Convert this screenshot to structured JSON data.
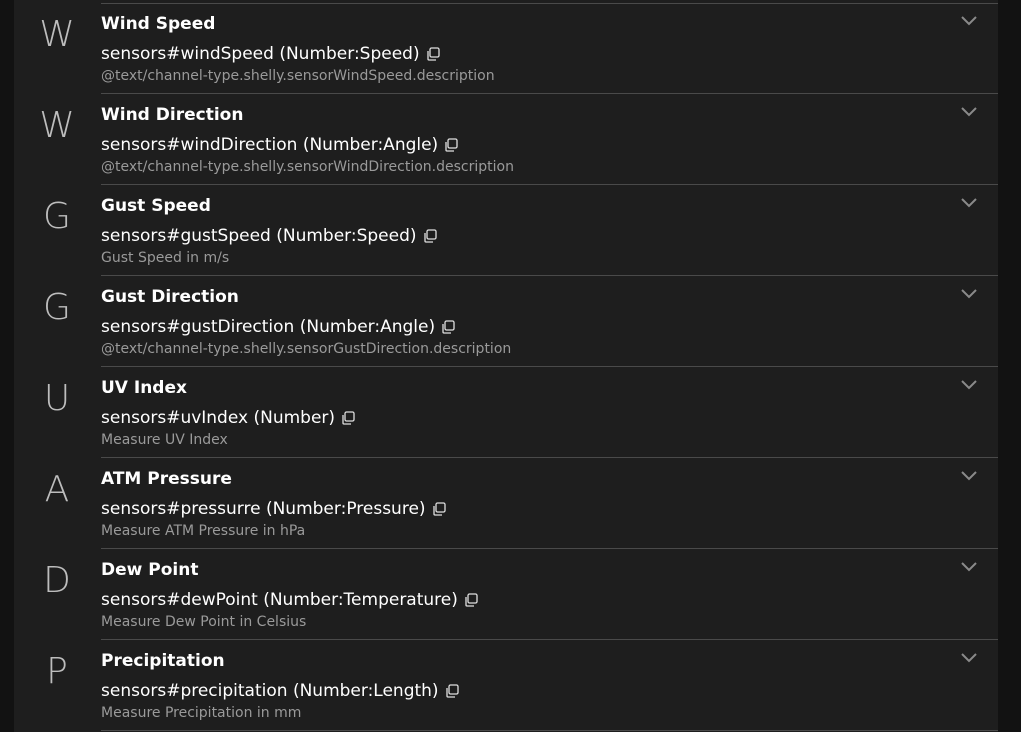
{
  "channels": [
    {
      "letter": "W",
      "title": "Wind Speed",
      "channel": "sensors#windSpeed (Number:Speed)",
      "description": "@text/channel-type.shelly.sensorWindSpeed.description"
    },
    {
      "letter": "W",
      "title": "Wind Direction",
      "channel": "sensors#windDirection (Number:Angle)",
      "description": "@text/channel-type.shelly.sensorWindDirection.description"
    },
    {
      "letter": "G",
      "title": "Gust Speed",
      "channel": "sensors#gustSpeed (Number:Speed)",
      "description": "Gust Speed in m/s"
    },
    {
      "letter": "G",
      "title": "Gust Direction",
      "channel": "sensors#gustDirection (Number:Angle)",
      "description": "@text/channel-type.shelly.sensorGustDirection.description"
    },
    {
      "letter": "U",
      "title": "UV Index",
      "channel": "sensors#uvIndex (Number)",
      "description": "Measure UV Index"
    },
    {
      "letter": "A",
      "title": "ATM Pressure",
      "channel": "sensors#pressurre (Number:Pressure)",
      "description": "Measure ATM Pressure in hPa"
    },
    {
      "letter": "D",
      "title": "Dew Point",
      "channel": "sensors#dewPoint (Number:Temperature)",
      "description": "Measure Dew Point in Celsius"
    },
    {
      "letter": "P",
      "title": "Precipitation",
      "channel": "sensors#precipitation (Number:Length)",
      "description": "Measure Precipitation in mm"
    }
  ],
  "icons": {
    "copy": "copy-icon",
    "expand": "chevron-down-icon"
  },
  "colors": {
    "background": "#121212",
    "panel": "#1e1e1e",
    "divider": "#4a4a4a",
    "text": "#ffffff",
    "secondary_text": "#9a9a9a",
    "letter": "#bdbdbd"
  }
}
